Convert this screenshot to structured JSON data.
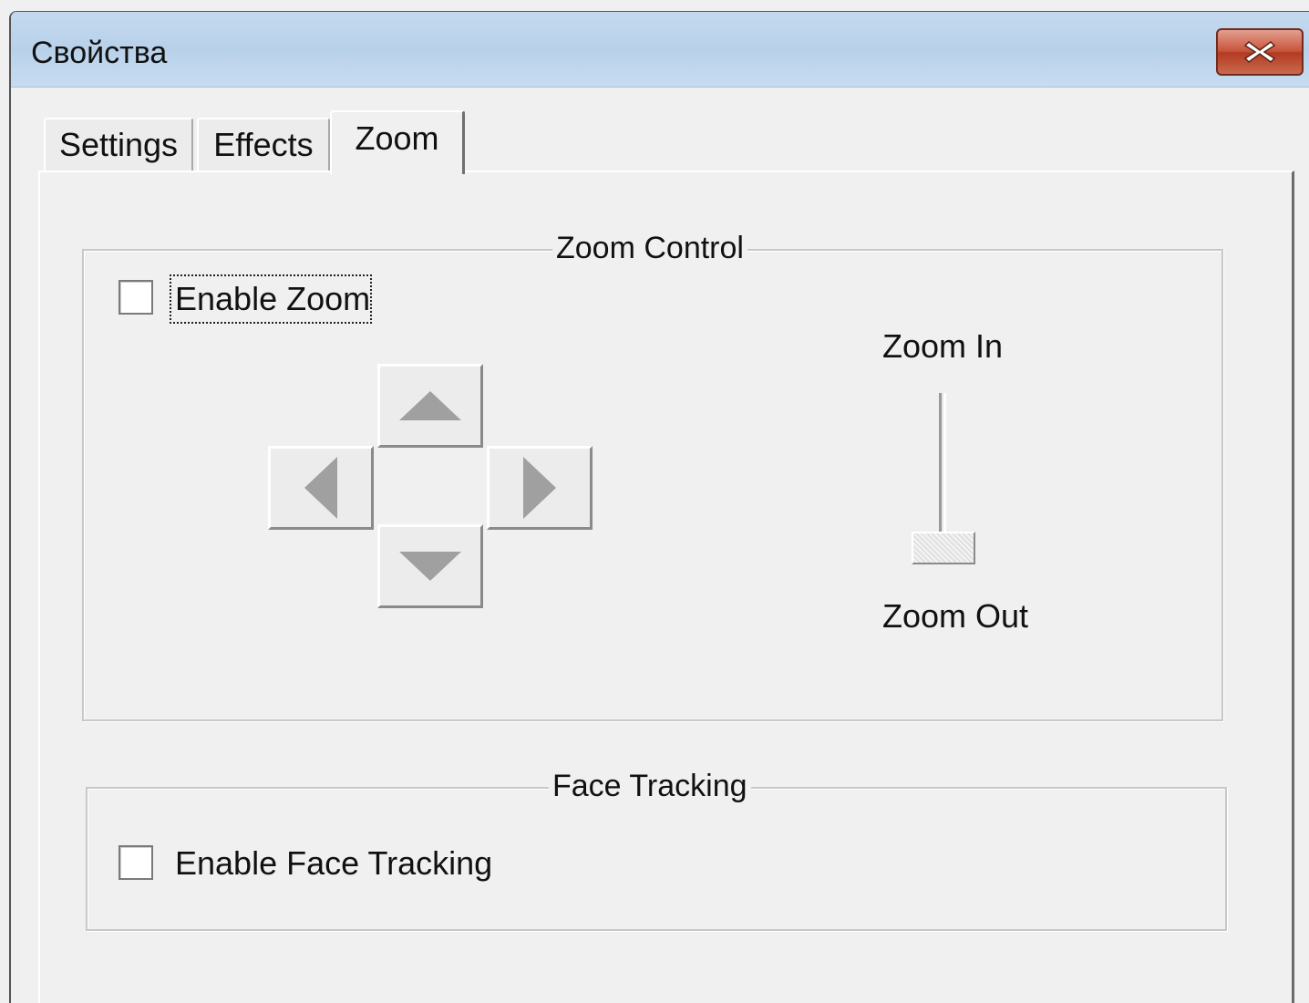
{
  "window": {
    "title": "Свойства",
    "close_icon": "close-x-icon"
  },
  "tabs": [
    {
      "label": "Settings",
      "active": false
    },
    {
      "label": "Effects",
      "active": false
    },
    {
      "label": "Zoom",
      "active": true
    }
  ],
  "zoom_control": {
    "group_label": "Zoom Control",
    "enable_zoom_label": "Enable Zoom",
    "enable_zoom_checked": false,
    "pan_buttons": {
      "up_icon": "triangle-up-icon",
      "down_icon": "triangle-down-icon",
      "left_icon": "triangle-left-icon",
      "right_icon": "triangle-right-icon"
    },
    "slider": {
      "top_label": "Zoom In",
      "bottom_label": "Zoom Out",
      "level": 0
    }
  },
  "face_tracking": {
    "group_label": "Face Tracking",
    "enable_label": "Enable Face Tracking",
    "enable_checked": false
  },
  "colors": {
    "titlebar": "#c4d9ee",
    "close_button": "#c8533c",
    "dialog_bg": "#f0f0f0",
    "arrow_glyph": "#a0a0a0"
  }
}
